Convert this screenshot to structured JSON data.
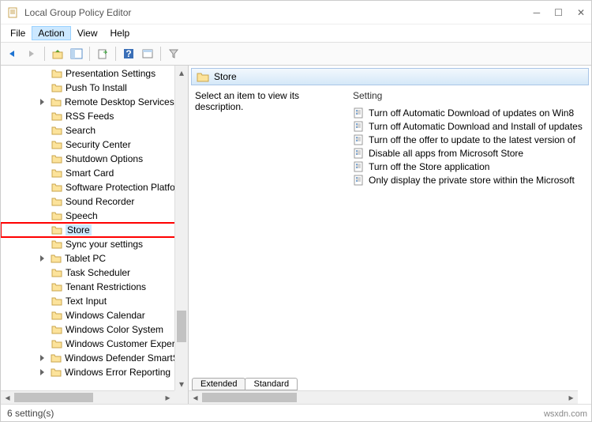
{
  "window": {
    "title": "Local Group Policy Editor"
  },
  "menu": {
    "file": "File",
    "action": "Action",
    "view": "View",
    "help": "Help"
  },
  "tree": {
    "items": [
      {
        "label": "Presentation Settings",
        "expandable": false
      },
      {
        "label": "Push To Install",
        "expandable": false
      },
      {
        "label": "Remote Desktop Services",
        "expandable": true
      },
      {
        "label": "RSS Feeds",
        "expandable": false
      },
      {
        "label": "Search",
        "expandable": false
      },
      {
        "label": "Security Center",
        "expandable": false
      },
      {
        "label": "Shutdown Options",
        "expandable": false
      },
      {
        "label": "Smart Card",
        "expandable": false
      },
      {
        "label": "Software Protection Platform",
        "expandable": false
      },
      {
        "label": "Sound Recorder",
        "expandable": false
      },
      {
        "label": "Speech",
        "expandable": false
      },
      {
        "label": "Store",
        "expandable": false,
        "selected": true
      },
      {
        "label": "Sync your settings",
        "expandable": false
      },
      {
        "label": "Tablet PC",
        "expandable": true
      },
      {
        "label": "Task Scheduler",
        "expandable": false
      },
      {
        "label": "Tenant Restrictions",
        "expandable": false
      },
      {
        "label": "Text Input",
        "expandable": false
      },
      {
        "label": "Windows Calendar",
        "expandable": false
      },
      {
        "label": "Windows Color System",
        "expandable": false
      },
      {
        "label": "Windows Customer Experience",
        "expandable": false
      },
      {
        "label": "Windows Defender SmartScreen",
        "expandable": true
      },
      {
        "label": "Windows Error Reporting",
        "expandable": true
      }
    ]
  },
  "right": {
    "header": "Store",
    "description": "Select an item to view its description.",
    "setting_header": "Setting",
    "settings": [
      "Turn off Automatic Download of updates on Win8",
      "Turn off Automatic Download and Install of updates",
      "Turn off the offer to update to the latest version of",
      "Disable all apps from Microsoft Store",
      "Turn off the Store application",
      "Only display the private store within the Microsoft"
    ]
  },
  "tabs": {
    "extended": "Extended",
    "standard": "Standard"
  },
  "status": "6 setting(s)",
  "watermark": "wsxdn.com"
}
